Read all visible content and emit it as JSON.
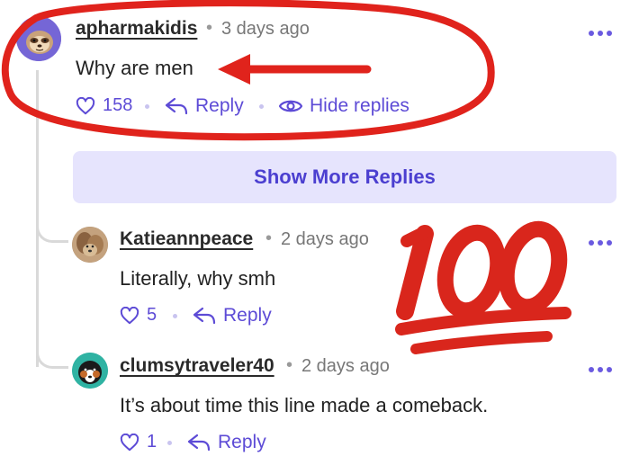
{
  "comments": [
    {
      "username": "apharmakidis",
      "time": "3 days ago",
      "text": "Why are men",
      "likes": "158",
      "reply_label": "Reply",
      "hide_replies_label": "Hide replies"
    },
    {
      "username": "Katieannpeace",
      "time": "2 days ago",
      "text": "Literally, why smh",
      "likes": "5",
      "reply_label": "Reply"
    },
    {
      "username": "clumsytraveler40",
      "time": "2 days ago",
      "text": "It’s about time this line made a comeback.",
      "likes": "1",
      "reply_label": "Reply"
    }
  ],
  "show_more_label": "Show More Replies",
  "overlay": {
    "sticker": "100",
    "annotation_color": "#e0231c",
    "sticker_color": "#d9261c"
  },
  "colors": {
    "accent": "#5d4bd6",
    "show_more_bg": "#e6e4fd"
  },
  "icons": [
    "heart-icon",
    "reply-arrow-icon",
    "eye-icon",
    "more-dots-icon"
  ]
}
